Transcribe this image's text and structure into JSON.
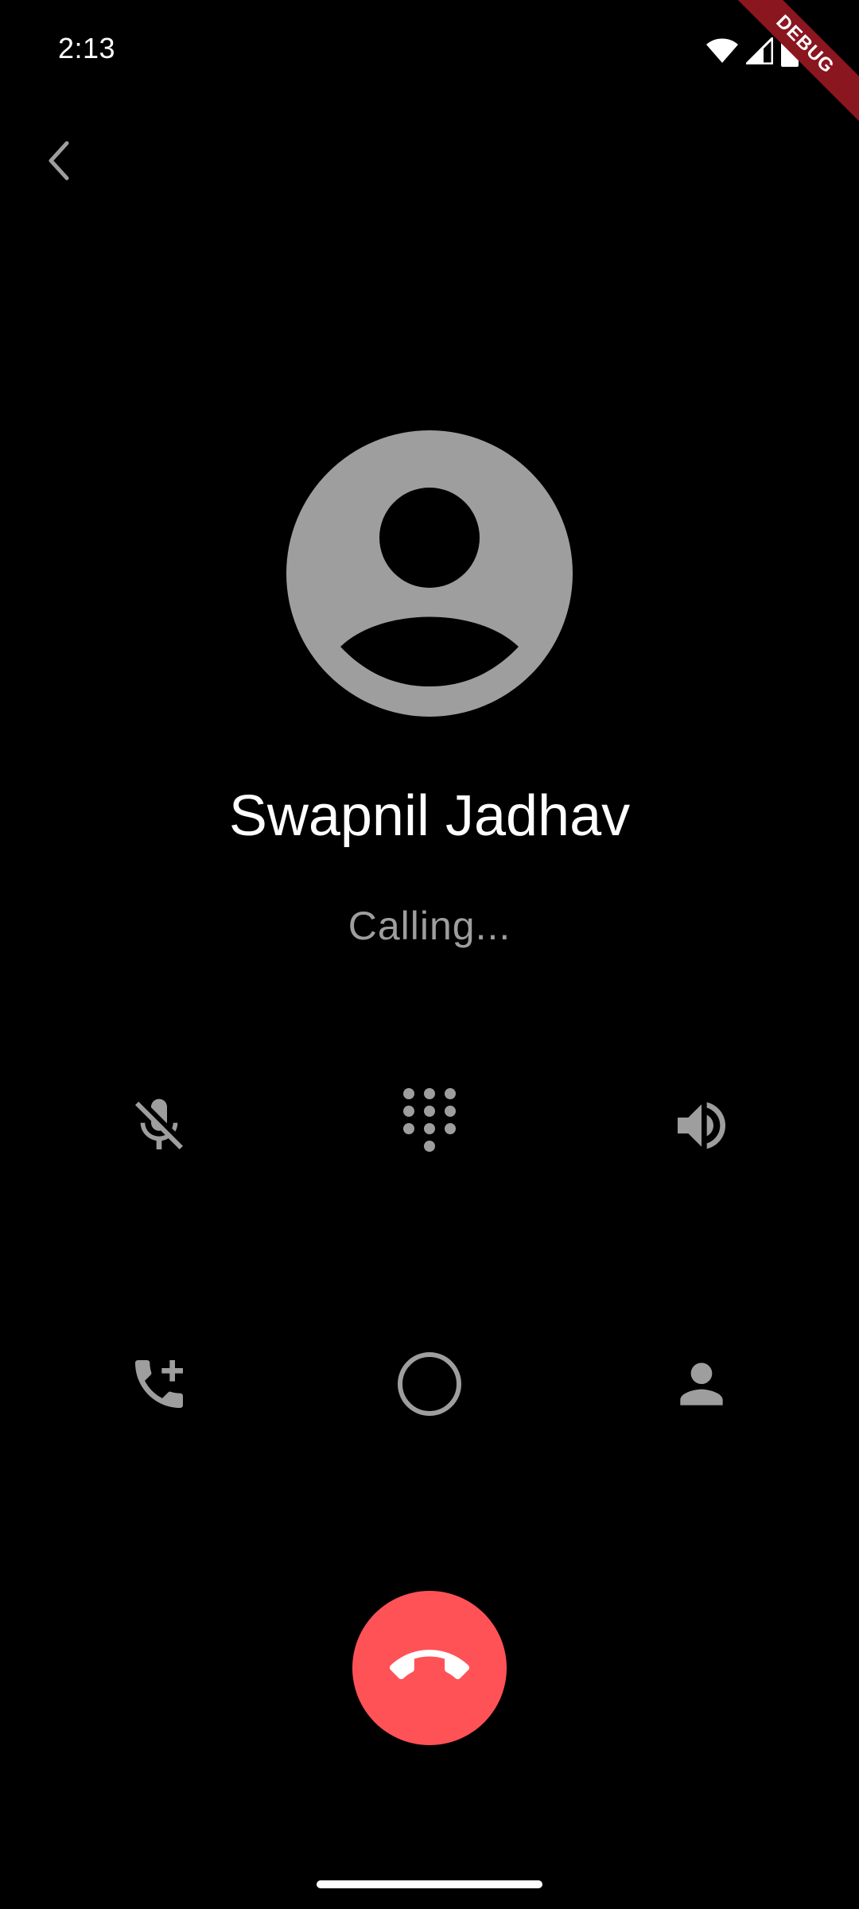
{
  "status_bar": {
    "time": "2:13",
    "icons": [
      "wifi-icon",
      "cellular-signal-icon",
      "battery-icon"
    ]
  },
  "debug_banner": {
    "label": "DEBUG",
    "color": "#8a1620"
  },
  "navigation": {
    "back_icon": "chevron-left-icon"
  },
  "caller": {
    "avatar_icon": "person-avatar-icon",
    "name": "Swapnil Jadhav",
    "status": "Calling..."
  },
  "controls": {
    "row1": [
      "mic-off-icon",
      "dialpad-icon",
      "speaker-icon"
    ],
    "row2": [
      "add-call-icon",
      "record-circle-icon",
      "person-icon"
    ]
  },
  "end_call": {
    "icon": "call-end-icon",
    "color": "#ff5257"
  },
  "colors": {
    "background": "#000000",
    "icon_gray": "#9e9e9e",
    "text_primary": "#ffffff"
  }
}
